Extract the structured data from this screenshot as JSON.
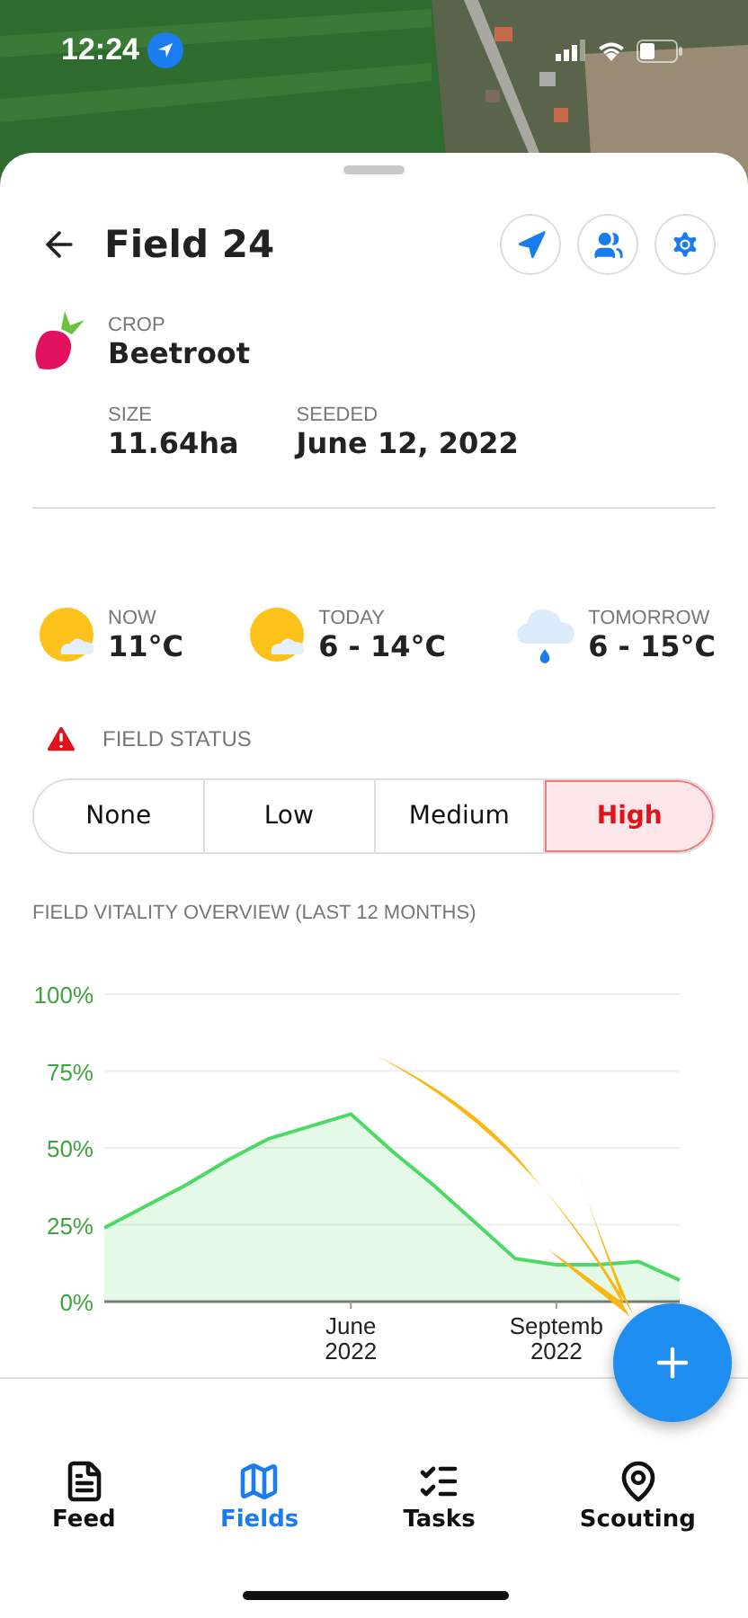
{
  "status_bar": {
    "time": "12:24"
  },
  "header": {
    "title": "Field 24",
    "actions": [
      {
        "kind": "navigate"
      },
      {
        "kind": "people"
      },
      {
        "kind": "settings"
      }
    ]
  },
  "crop": {
    "label": "CROP",
    "name": "Beetroot"
  },
  "details": [
    {
      "label": "SIZE",
      "value": "11.64ha"
    },
    {
      "label": "SEEDED",
      "value": "June 12, 2022"
    }
  ],
  "weather": [
    {
      "label": "NOW",
      "value": "11°C",
      "kind": "partly_sunny"
    },
    {
      "label": "TODAY",
      "value": "6 - 14°C",
      "kind": "partly_sunny"
    },
    {
      "label": "TOMORROW",
      "value": "6 - 15°C",
      "kind": "rain"
    }
  ],
  "field_status": {
    "label": "FIELD STATUS",
    "options": [
      {
        "label": "None",
        "selected": false
      },
      {
        "label": "Low",
        "selected": false
      },
      {
        "label": "Medium",
        "selected": false
      },
      {
        "label": "High",
        "selected": true
      }
    ]
  },
  "vitality": {
    "title": "FIELD VITALITY OVERVIEW (LAST 12 MONTHS)",
    "chart_data": {
      "type": "area",
      "categories": [
        null,
        null,
        null,
        null,
        null,
        null,
        "June\n2022",
        null,
        null,
        null,
        null,
        "Septemb\n2022",
        null,
        null,
        null
      ],
      "series": [
        {
          "color": "#4cd964",
          "values": [
            24,
            31,
            38,
            46,
            53,
            57,
            61,
            49,
            38,
            26,
            14,
            12,
            12,
            13,
            7
          ]
        }
      ],
      "grid": true,
      "ylim": [
        0,
        100
      ],
      "yticks": [
        {
          "value": 0,
          "label": "0%"
        },
        {
          "value": 25,
          "label": "25%"
        },
        {
          "value": 50,
          "label": "50%"
        },
        {
          "value": 75,
          "label": "75%"
        },
        {
          "value": 100,
          "label": "100%"
        }
      ]
    }
  },
  "tabs": [
    {
      "label": "Feed",
      "kind": "feed",
      "selected": false
    },
    {
      "label": "Fields",
      "kind": "map",
      "selected": true
    },
    {
      "label": "Tasks",
      "kind": "tasks",
      "selected": false
    },
    {
      "label": "Scouting",
      "kind": "pin",
      "selected": false
    }
  ]
}
